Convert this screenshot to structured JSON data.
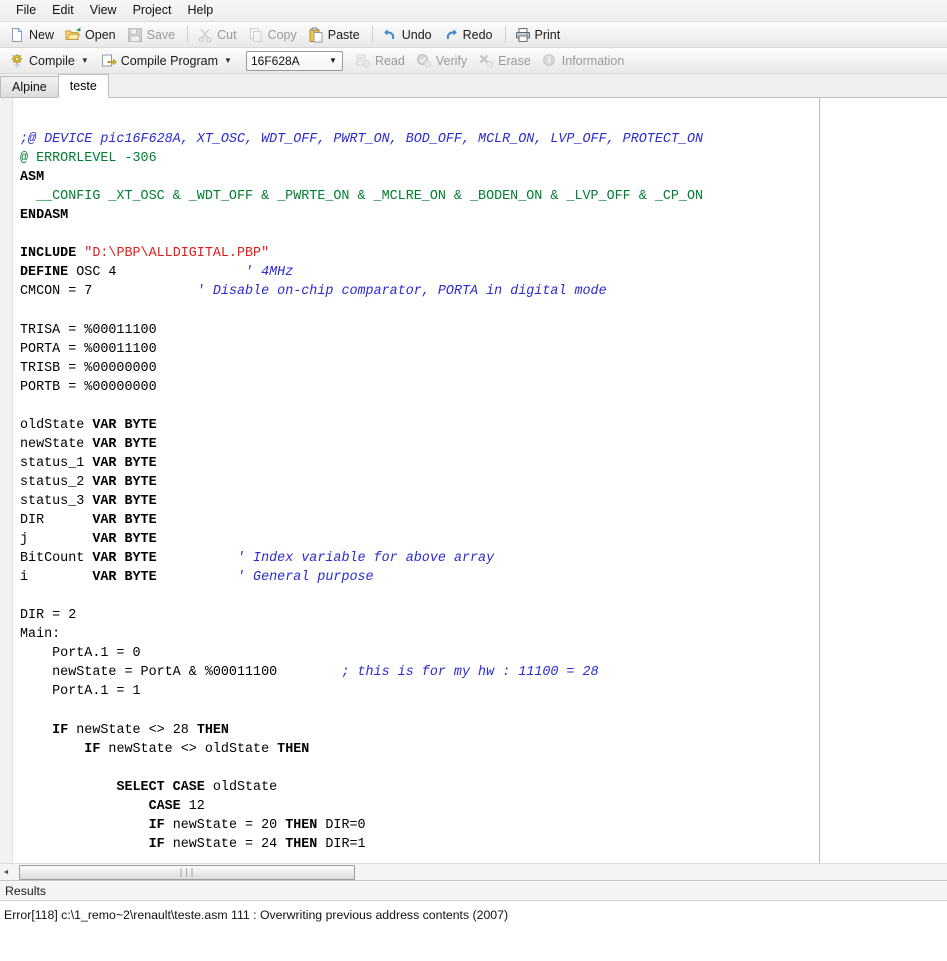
{
  "menubar": {
    "items": [
      {
        "label": "File",
        "name": "menu-file"
      },
      {
        "label": "Edit",
        "name": "menu-edit"
      },
      {
        "label": "View",
        "name": "menu-view"
      },
      {
        "label": "Project",
        "name": "menu-project"
      },
      {
        "label": "Help",
        "name": "menu-help"
      }
    ]
  },
  "toolbar1": {
    "new_label": "New",
    "open_label": "Open",
    "save_label": "Save",
    "cut_label": "Cut",
    "copy_label": "Copy",
    "paste_label": "Paste",
    "undo_label": "Undo",
    "redo_label": "Redo",
    "print_label": "Print"
  },
  "toolbar2": {
    "compile_label": "Compile",
    "compile_program_label": "Compile Program",
    "device_value": "16F628A",
    "read_label": "Read",
    "verify_label": "Verify",
    "erase_label": "Erase",
    "information_label": "Information",
    "caret_glyph": "▼"
  },
  "tabs": [
    {
      "label": "Alpine",
      "name": "tab-alpine",
      "active": false
    },
    {
      "label": "teste",
      "name": "tab-teste",
      "active": true
    }
  ],
  "editor": {
    "lines": [
      [],
      [
        {
          "t": ";@ DEVICE pic16F628A, XT_OSC, WDT_OFF, PWRT_ON, BOD_OFF, MCLR_ON, LVP_OFF, PROTECT_ON",
          "c": "cmt"
        }
      ],
      [
        {
          "t": "@ ERRORLEVEL -306",
          "c": "dir"
        }
      ],
      [
        {
          "t": "ASM",
          "c": "kw"
        }
      ],
      [
        {
          "t": "  __CONFIG _XT_OSC & _WDT_OFF & _PWRTE_ON & _MCLRE_ON & _BODEN_ON & _LVP_OFF & _CP_ON",
          "c": "dir"
        }
      ],
      [
        {
          "t": "ENDASM",
          "c": "kw"
        }
      ],
      [],
      [
        {
          "t": "INCLUDE",
          "c": "kw"
        },
        {
          "t": " ",
          "c": "plain"
        },
        {
          "t": "\"D:\\PBP\\ALLDIGITAL.PBP\"",
          "c": "str"
        }
      ],
      [
        {
          "t": "DEFINE",
          "c": "kw"
        },
        {
          "t": " OSC 4                ",
          "c": "plain"
        },
        {
          "t": "' 4MHz",
          "c": "cmt"
        }
      ],
      [
        {
          "t": "CMCON = 7             ",
          "c": "plain"
        },
        {
          "t": "' Disable on-chip comparator, PORTA in digital mode",
          "c": "cmt"
        }
      ],
      [],
      [
        {
          "t": "TRISA = %00011100",
          "c": "plain"
        }
      ],
      [
        {
          "t": "PORTA = %00011100",
          "c": "plain"
        }
      ],
      [
        {
          "t": "TRISB = %00000000",
          "c": "plain"
        }
      ],
      [
        {
          "t": "PORTB = %00000000",
          "c": "plain"
        }
      ],
      [],
      [
        {
          "t": "oldState ",
          "c": "plain"
        },
        {
          "t": "VAR BYTE",
          "c": "kw"
        }
      ],
      [
        {
          "t": "newState ",
          "c": "plain"
        },
        {
          "t": "VAR BYTE",
          "c": "kw"
        }
      ],
      [
        {
          "t": "status_1 ",
          "c": "plain"
        },
        {
          "t": "VAR BYTE",
          "c": "kw"
        }
      ],
      [
        {
          "t": "status_2 ",
          "c": "plain"
        },
        {
          "t": "VAR BYTE",
          "c": "kw"
        }
      ],
      [
        {
          "t": "status_3 ",
          "c": "plain"
        },
        {
          "t": "VAR BYTE",
          "c": "kw"
        }
      ],
      [
        {
          "t": "DIR      ",
          "c": "plain"
        },
        {
          "t": "VAR BYTE",
          "c": "kw"
        }
      ],
      [
        {
          "t": "j        ",
          "c": "plain"
        },
        {
          "t": "VAR BYTE",
          "c": "kw"
        }
      ],
      [
        {
          "t": "BitCount ",
          "c": "plain"
        },
        {
          "t": "VAR BYTE",
          "c": "kw"
        },
        {
          "t": "          ",
          "c": "plain"
        },
        {
          "t": "' Index variable for above array",
          "c": "cmt"
        }
      ],
      [
        {
          "t": "i        ",
          "c": "plain"
        },
        {
          "t": "VAR BYTE",
          "c": "kw"
        },
        {
          "t": "          ",
          "c": "plain"
        },
        {
          "t": "' General purpose",
          "c": "cmt"
        }
      ],
      [],
      [
        {
          "t": "DIR = 2",
          "c": "plain"
        }
      ],
      [
        {
          "t": "Main:",
          "c": "plain"
        }
      ],
      [
        {
          "t": "    PortA.1 = 0",
          "c": "plain"
        }
      ],
      [
        {
          "t": "    newState = PortA & %00011100        ",
          "c": "plain"
        },
        {
          "t": "; this is for my hw : 11100 = 28",
          "c": "cmt"
        }
      ],
      [
        {
          "t": "    PortA.1 = 1",
          "c": "plain"
        }
      ],
      [],
      [
        {
          "t": "    ",
          "c": "plain"
        },
        {
          "t": "IF",
          "c": "kw"
        },
        {
          "t": " newState <> 28 ",
          "c": "plain"
        },
        {
          "t": "THEN",
          "c": "kw"
        }
      ],
      [
        {
          "t": "        ",
          "c": "plain"
        },
        {
          "t": "IF",
          "c": "kw"
        },
        {
          "t": " newState <> oldState ",
          "c": "plain"
        },
        {
          "t": "THEN",
          "c": "kw"
        }
      ],
      [],
      [
        {
          "t": "            ",
          "c": "plain"
        },
        {
          "t": "SELECT CASE",
          "c": "kw"
        },
        {
          "t": " oldState",
          "c": "plain"
        }
      ],
      [
        {
          "t": "                ",
          "c": "plain"
        },
        {
          "t": "CASE",
          "c": "kw"
        },
        {
          "t": " 12",
          "c": "plain"
        }
      ],
      [
        {
          "t": "                ",
          "c": "plain"
        },
        {
          "t": "IF",
          "c": "kw"
        },
        {
          "t": " newState = 20 ",
          "c": "plain"
        },
        {
          "t": "THEN",
          "c": "kw"
        },
        {
          "t": " DIR=0",
          "c": "plain"
        }
      ],
      [
        {
          "t": "                ",
          "c": "plain"
        },
        {
          "t": "IF",
          "c": "kw"
        },
        {
          "t": " newState = 24 ",
          "c": "plain"
        },
        {
          "t": "THEN",
          "c": "kw"
        },
        {
          "t": " DIR=1",
          "c": "plain"
        }
      ]
    ]
  },
  "scrollbar": {
    "left_arrow_glyph": "◄",
    "grip_glyph": "∣∣∣"
  },
  "results": {
    "header_label": "Results",
    "lines": [
      "Error[118] c:\\1_remo~2\\renault\\teste.asm 111 : Overwriting previous address contents (2007)"
    ]
  },
  "colors": {
    "comment": "#2b2bd0",
    "directive": "#007f32",
    "string": "#e01b1b",
    "keyword": "#000000",
    "tab_active_bg": "#ffffff",
    "chrome_bg": "#f0f0f0"
  }
}
